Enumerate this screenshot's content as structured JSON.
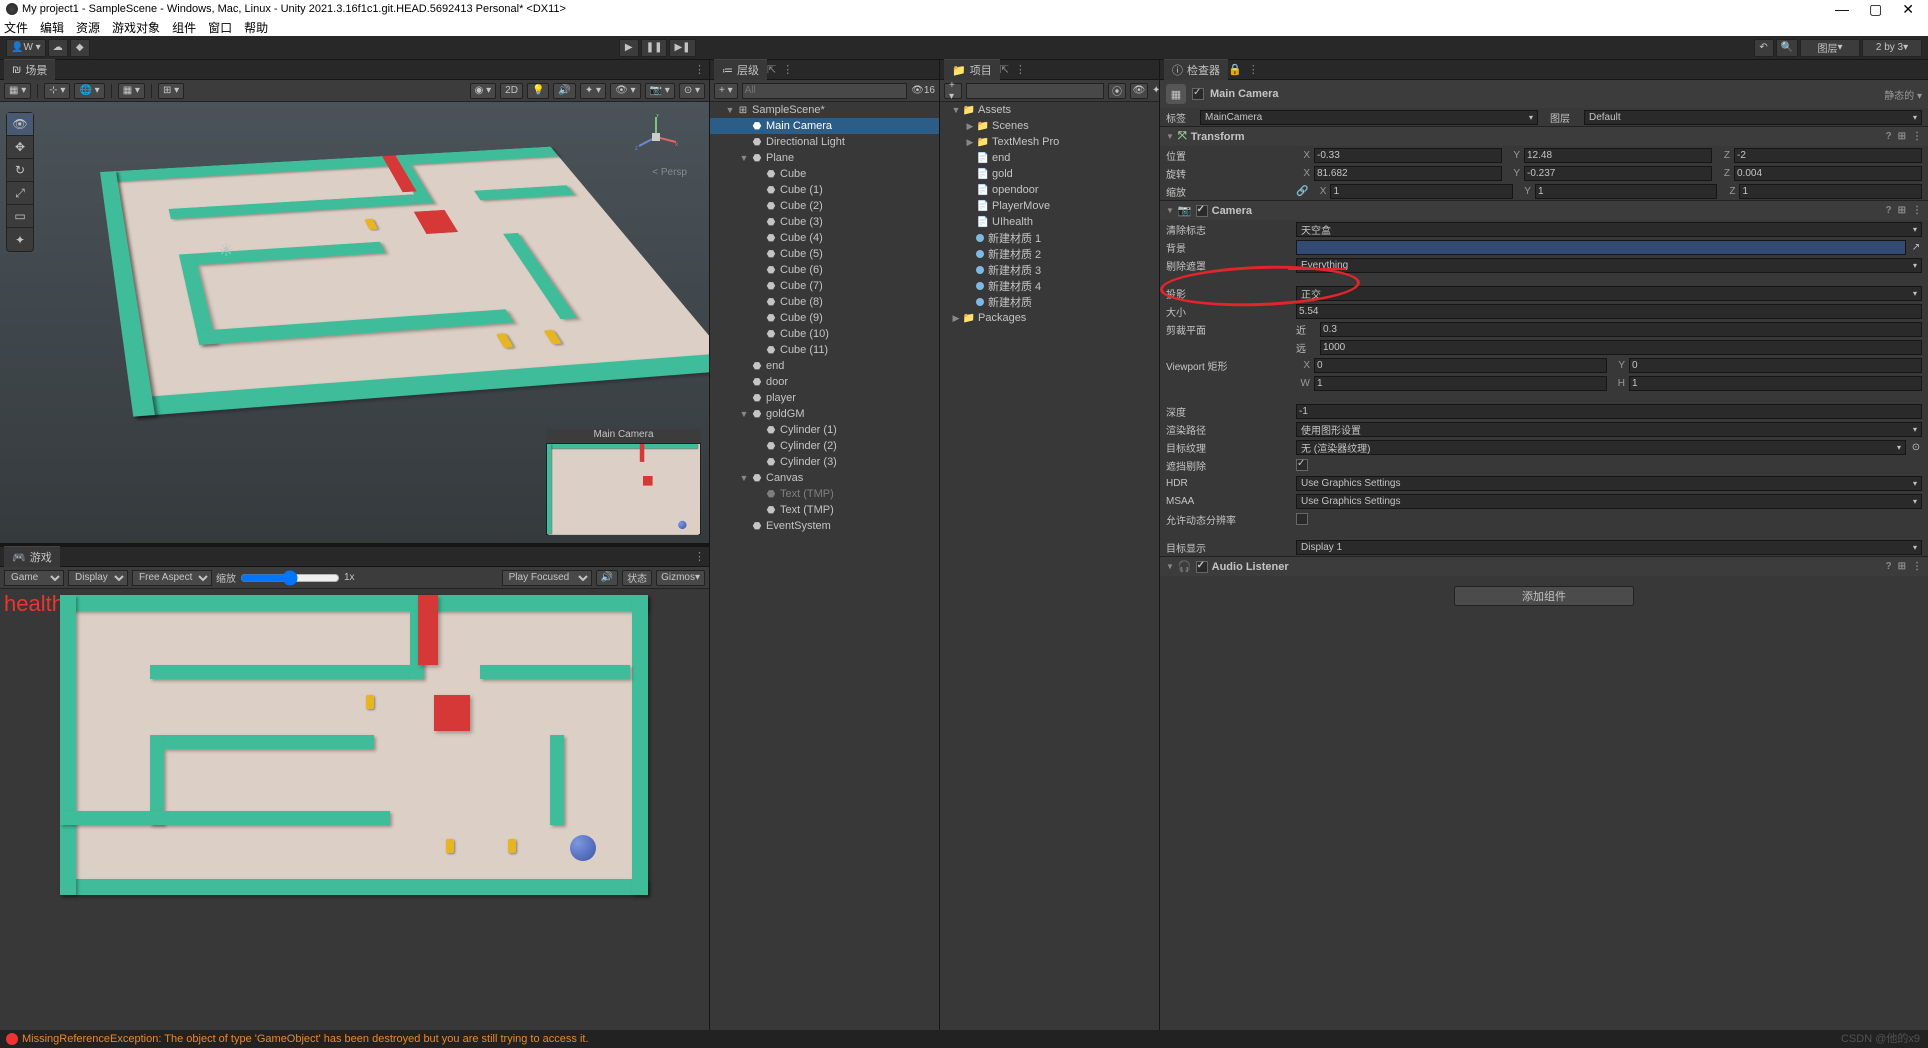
{
  "window": {
    "title": "My project1 - SampleScene - Windows, Mac, Linux - Unity 2021.3.16f1c1.git.HEAD.5692413 Personal* <DX11>"
  },
  "menubar": [
    "文件",
    "编辑",
    "资源",
    "游戏对象",
    "组件",
    "窗口",
    "帮助"
  ],
  "topbar": {
    "account": "W ▾",
    "layers": "图层",
    "layout": "2 by 3"
  },
  "scene_tab": "场景",
  "scene_toolbar": {
    "mode2d": "2D",
    "persp": "< Persp"
  },
  "cam_preview_title": "Main Camera",
  "game_tab": "游戏",
  "game_toolbar": {
    "game": "Game",
    "display": "Display 1",
    "aspect": "Free Aspect",
    "scale_label": "缩放",
    "scale_value": "1x",
    "play_focused": "Play Focused",
    "status": "状态",
    "gizmos": "Gizmos"
  },
  "health_overlay": "health:",
  "hierarchy": {
    "tab": "层级",
    "search_placeholder": "All",
    "count": "16",
    "items": [
      {
        "depth": 0,
        "expand": "▼",
        "icon": "⊞",
        "label": "SampleScene*"
      },
      {
        "depth": 1,
        "expand": "",
        "icon": "⬣",
        "label": "Main Camera",
        "selected": true
      },
      {
        "depth": 1,
        "expand": "",
        "icon": "⬣",
        "label": "Directional Light"
      },
      {
        "depth": 1,
        "expand": "▼",
        "icon": "⬣",
        "label": "Plane"
      },
      {
        "depth": 2,
        "expand": "",
        "icon": "⬣",
        "label": "Cube"
      },
      {
        "depth": 2,
        "expand": "",
        "icon": "⬣",
        "label": "Cube (1)"
      },
      {
        "depth": 2,
        "expand": "",
        "icon": "⬣",
        "label": "Cube (2)"
      },
      {
        "depth": 2,
        "expand": "",
        "icon": "⬣",
        "label": "Cube (3)"
      },
      {
        "depth": 2,
        "expand": "",
        "icon": "⬣",
        "label": "Cube (4)"
      },
      {
        "depth": 2,
        "expand": "",
        "icon": "⬣",
        "label": "Cube (5)"
      },
      {
        "depth": 2,
        "expand": "",
        "icon": "⬣",
        "label": "Cube (6)"
      },
      {
        "depth": 2,
        "expand": "",
        "icon": "⬣",
        "label": "Cube (7)"
      },
      {
        "depth": 2,
        "expand": "",
        "icon": "⬣",
        "label": "Cube (8)"
      },
      {
        "depth": 2,
        "expand": "",
        "icon": "⬣",
        "label": "Cube (9)"
      },
      {
        "depth": 2,
        "expand": "",
        "icon": "⬣",
        "label": "Cube (10)"
      },
      {
        "depth": 2,
        "expand": "",
        "icon": "⬣",
        "label": "Cube (11)"
      },
      {
        "depth": 1,
        "expand": "",
        "icon": "⬣",
        "label": "end"
      },
      {
        "depth": 1,
        "expand": "",
        "icon": "⬣",
        "label": "door"
      },
      {
        "depth": 1,
        "expand": "",
        "icon": "⬣",
        "label": "player"
      },
      {
        "depth": 1,
        "expand": "▼",
        "icon": "⬣",
        "label": "goldGM"
      },
      {
        "depth": 2,
        "expand": "",
        "icon": "⬣",
        "label": "Cylinder (1)"
      },
      {
        "depth": 2,
        "expand": "",
        "icon": "⬣",
        "label": "Cylinder (2)"
      },
      {
        "depth": 2,
        "expand": "",
        "icon": "⬣",
        "label": "Cylinder (3)"
      },
      {
        "depth": 1,
        "expand": "▼",
        "icon": "⬣",
        "label": "Canvas"
      },
      {
        "depth": 2,
        "expand": "",
        "icon": "⬣",
        "label": "Text (TMP)",
        "disabled": true
      },
      {
        "depth": 2,
        "expand": "",
        "icon": "⬣",
        "label": "Text (TMP)"
      },
      {
        "depth": 1,
        "expand": "",
        "icon": "⬣",
        "label": "EventSystem"
      }
    ]
  },
  "project": {
    "tab": "项目",
    "items": [
      {
        "depth": 0,
        "expand": "▼",
        "icon": "📁",
        "label": "Assets"
      },
      {
        "depth": 1,
        "expand": "▶",
        "icon": "📁",
        "label": "Scenes"
      },
      {
        "depth": 1,
        "expand": "▶",
        "icon": "📁",
        "label": "TextMesh Pro"
      },
      {
        "depth": 1,
        "expand": "",
        "icon": "📄",
        "label": "end"
      },
      {
        "depth": 1,
        "expand": "",
        "icon": "📄",
        "label": "gold"
      },
      {
        "depth": 1,
        "expand": "",
        "icon": "📄",
        "label": "opendoor"
      },
      {
        "depth": 1,
        "expand": "",
        "icon": "📄",
        "label": "PlayerMove"
      },
      {
        "depth": 1,
        "expand": "",
        "icon": "📄",
        "label": "UIhealth"
      },
      {
        "depth": 1,
        "expand": "",
        "icon": "●",
        "label": "新建材质 1"
      },
      {
        "depth": 1,
        "expand": "",
        "icon": "●",
        "label": "新建材质 2"
      },
      {
        "depth": 1,
        "expand": "",
        "icon": "●",
        "label": "新建材质 3"
      },
      {
        "depth": 1,
        "expand": "",
        "icon": "●",
        "label": "新建材质 4"
      },
      {
        "depth": 1,
        "expand": "",
        "icon": "●",
        "label": "新建材质"
      },
      {
        "depth": 0,
        "expand": "▶",
        "icon": "📁",
        "label": "Packages"
      }
    ]
  },
  "inspector": {
    "tab": "检查器",
    "locked": "锁定的",
    "obj_name": "Main Camera",
    "static_label": "静态的",
    "tag_label": "标签",
    "tag_value": "MainCamera",
    "layer_label": "图层",
    "layer_value": "Default",
    "transform": {
      "title": "Transform",
      "position_label": "位置",
      "rotation_label": "旋转",
      "scale_label": "缩放",
      "pos": {
        "x": "-0.33",
        "y": "12.48",
        "z": "-2"
      },
      "rot": {
        "x": "81.682",
        "y": "-0.237",
        "z": "0.004"
      },
      "scale": {
        "x": "1",
        "y": "1",
        "z": "1"
      }
    },
    "camera": {
      "title": "Camera",
      "clear_flags_label": "清除标志",
      "clear_flags_value": "天空盒",
      "background_label": "背景",
      "culling_mask_label": "剔除遮罩",
      "culling_mask_value": "Everything",
      "projection_label": "投影",
      "projection_value": "正交",
      "size_label": "大小",
      "size_value": "5.54",
      "clipping_label": "剪裁平面",
      "near_label": "近",
      "near_value": "0.3",
      "far_label": "远",
      "far_value": "1000",
      "viewport_label": "Viewport 矩形",
      "viewport": {
        "x": "0",
        "y": "0",
        "w": "1",
        "h": "1"
      },
      "depth_label": "深度",
      "depth_value": "-1",
      "rendering_path_label": "渲染路径",
      "rendering_path_value": "使用图形设置",
      "target_texture_label": "目标纹理",
      "target_texture_value": "无 (渲染器纹理)",
      "occlusion_label": "遮挡剔除",
      "hdr_label": "HDR",
      "hdr_value": "Use Graphics Settings",
      "msaa_label": "MSAA",
      "msaa_value": "Use Graphics Settings",
      "dynamic_res_label": "允许动态分辨率",
      "target_display_label": "目标显示",
      "target_display_value": "Display 1"
    },
    "audio_listener": {
      "title": "Audio Listener"
    },
    "add_component": "添加组件"
  },
  "statusbar": {
    "error": "MissingReferenceException: The object of type 'GameObject' has been destroyed but you are still trying to access it."
  },
  "watermark": "CSDN @他的x9"
}
